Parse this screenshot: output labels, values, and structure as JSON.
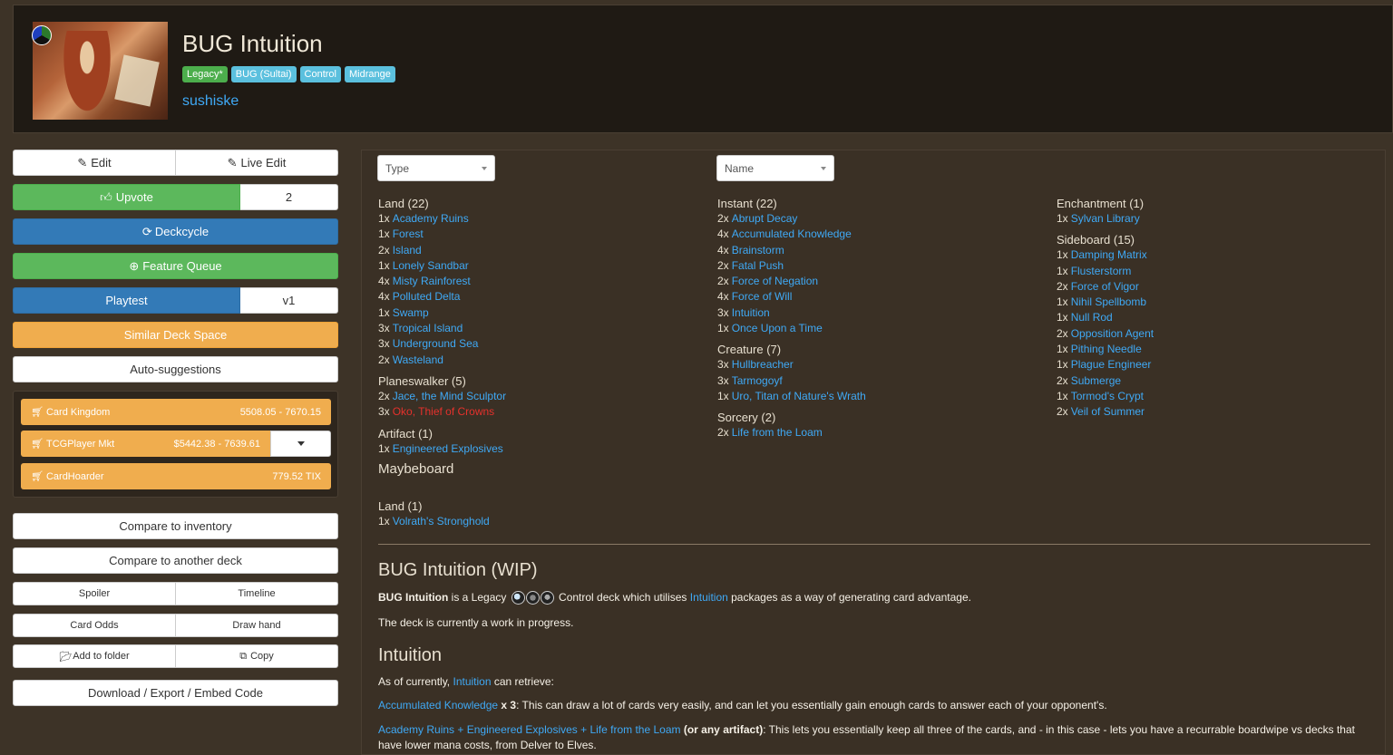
{
  "header": {
    "title": "BUG Intuition",
    "tags": [
      "Legacy*",
      "BUG (Sultai)",
      "Control",
      "Midrange"
    ],
    "author": "sushiske"
  },
  "sidebar": {
    "edit": "Edit",
    "live_edit": "Live Edit",
    "upvote": "Upvote",
    "upvote_count": "2",
    "deckcycle": "Deckcycle",
    "feature_queue": "Feature Queue",
    "playtest": "Playtest",
    "playtest_version": "v1",
    "similar_deck_space": "Similar Deck Space",
    "auto_suggestions": "Auto-suggestions",
    "prices": [
      {
        "vendor": "Card Kingdom",
        "price": "5508.05 - 7670.15"
      },
      {
        "vendor": "TCGPlayer Mkt",
        "price": "$5442.38 - 7639.61"
      },
      {
        "vendor": "CardHoarder",
        "price": "779.52 TIX"
      }
    ],
    "compare_inventory": "Compare to inventory",
    "compare_deck": "Compare to another deck",
    "spoiler": "Spoiler",
    "timeline": "Timeline",
    "card_odds": "Card Odds",
    "draw_hand": "Draw hand",
    "add_folder": "Add to folder",
    "copy": "Copy",
    "download": "Download / Export / Embed Code"
  },
  "filters": {
    "group_by": "Type",
    "sort_by": "Name"
  },
  "columns": [
    [
      {
        "title": "Land (22)",
        "cards": [
          [
            "1x",
            "Academy Ruins"
          ],
          [
            "1x",
            "Forest"
          ],
          [
            "2x",
            "Island"
          ],
          [
            "1x",
            "Lonely Sandbar"
          ],
          [
            "4x",
            "Misty Rainforest"
          ],
          [
            "4x",
            "Polluted Delta"
          ],
          [
            "1x",
            "Swamp"
          ],
          [
            "3x",
            "Tropical Island"
          ],
          [
            "3x",
            "Underground Sea"
          ],
          [
            "2x",
            "Wasteland"
          ]
        ]
      },
      {
        "title": "Planeswalker (5)",
        "cards": [
          [
            "2x",
            "Jace, the Mind Sculptor"
          ],
          [
            "3x",
            "Oko, Thief of Crowns"
          ]
        ]
      },
      {
        "title": "Artifact (1)",
        "cards": [
          [
            "1x",
            "Engineered Explosives"
          ]
        ]
      }
    ],
    [
      {
        "title": "Instant (22)",
        "cards": [
          [
            "2x",
            "Abrupt Decay"
          ],
          [
            "4x",
            "Accumulated Knowledge"
          ],
          [
            "4x",
            "Brainstorm"
          ],
          [
            "2x",
            "Fatal Push"
          ],
          [
            "2x",
            "Force of Negation"
          ],
          [
            "4x",
            "Force of Will"
          ],
          [
            "3x",
            "Intuition"
          ],
          [
            "1x",
            "Once Upon a Time"
          ]
        ]
      },
      {
        "title": "Creature (7)",
        "cards": [
          [
            "3x",
            "Hullbreacher"
          ],
          [
            "3x",
            "Tarmogoyf"
          ],
          [
            "1x",
            "Uro, Titan of Nature's Wrath"
          ]
        ]
      },
      {
        "title": "Sorcery (2)",
        "cards": [
          [
            "2x",
            "Life from the Loam"
          ]
        ]
      }
    ],
    [
      {
        "title": "Enchantment (1)",
        "cards": [
          [
            "1x",
            "Sylvan Library"
          ]
        ]
      },
      {
        "title": "Sideboard (15)",
        "cards": [
          [
            "1x",
            "Damping Matrix"
          ],
          [
            "1x",
            "Flusterstorm"
          ],
          [
            "2x",
            "Force of Vigor"
          ],
          [
            "1x",
            "Nihil Spellbomb"
          ],
          [
            "1x",
            "Null Rod"
          ],
          [
            "2x",
            "Opposition Agent"
          ],
          [
            "1x",
            "Pithing Needle"
          ],
          [
            "1x",
            "Plague Engineer"
          ],
          [
            "2x",
            "Submerge"
          ],
          [
            "1x",
            "Tormod's Crypt"
          ],
          [
            "2x",
            "Veil of Summer"
          ]
        ]
      }
    ]
  ],
  "maybeboard": {
    "title": "Maybeboard",
    "section": "Land (1)",
    "cards": [
      [
        "1x",
        "Volrath's Stronghold"
      ]
    ]
  },
  "description": {
    "heading": "BUG Intuition (WIP)",
    "p1_bold": "BUG Intuition",
    "p1_a": " is a Legacy ",
    "p1_b": " Control deck which utilises ",
    "p1_link": "Intuition",
    "p1_c": " packages as a way of generating card advantage.",
    "p2": "The deck is currently a work in progress.",
    "heading2": "Intuition",
    "p3_a": "As of currently, ",
    "p3_link": "Intuition",
    "p3_b": " can retrieve:",
    "p4_link": "Accumulated Knowledge",
    "p4_bold": " x 3",
    "p4_text": ": This can draw a lot of cards very easily, and can let you essentially gain enough cards to answer each of your opponent's.",
    "p5_link": "Academy Ruins + Engineered Explosives + Life from the Loam",
    "p5_bold": " (or any artifact)",
    "p5_text": ": This lets you essentially keep all three of the cards, and - in this case - lets you have a recurrable boardwipe vs decks that have lower mana costs, from Delver to Elves."
  },
  "colors": {
    "accent_blue": "#3fa9f5",
    "green": "#5cb85c",
    "blue": "#337ab7",
    "orange": "#f0ad4e",
    "red": "#e5312c"
  }
}
